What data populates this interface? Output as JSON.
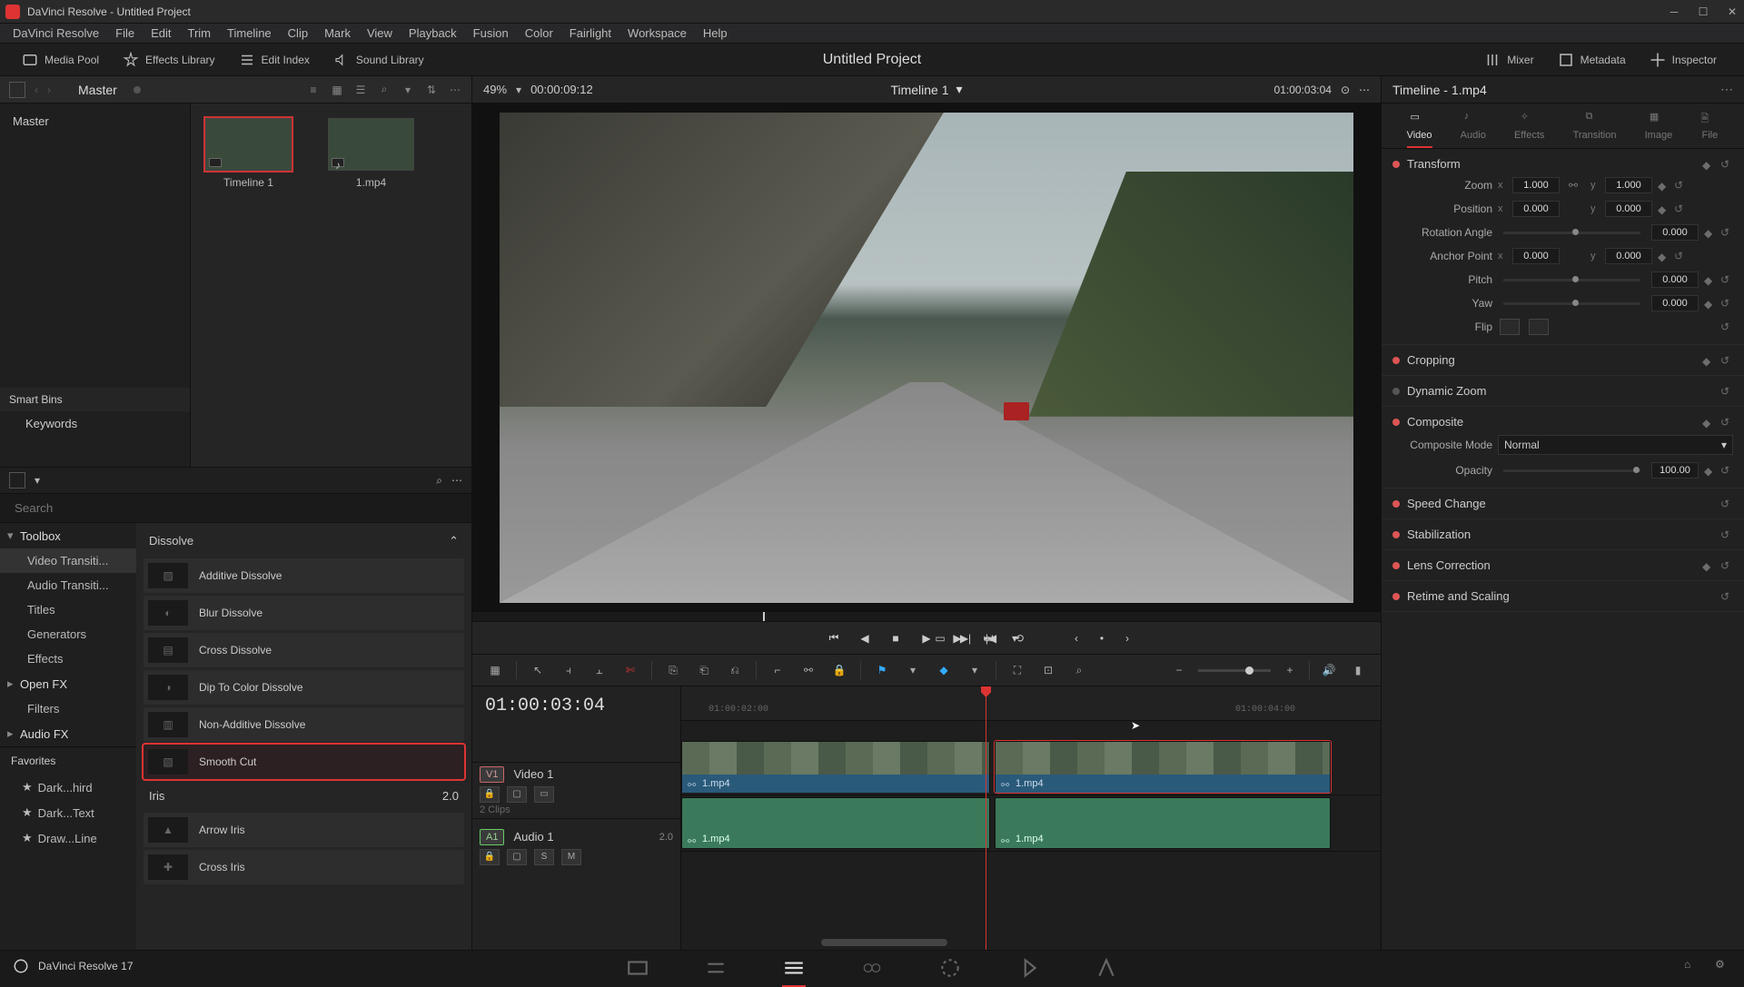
{
  "window": {
    "title": "DaVinci Resolve - Untitled Project"
  },
  "menu": [
    "DaVinci Resolve",
    "File",
    "Edit",
    "Trim",
    "Timeline",
    "Clip",
    "Mark",
    "View",
    "Playback",
    "Fusion",
    "Color",
    "Fairlight",
    "Workspace",
    "Help"
  ],
  "uibar": {
    "left": [
      {
        "label": "Media Pool"
      },
      {
        "label": "Effects Library"
      },
      {
        "label": "Edit Index"
      },
      {
        "label": "Sound Library"
      }
    ],
    "project": "Untitled Project",
    "right": [
      {
        "label": "Mixer"
      },
      {
        "label": "Metadata"
      },
      {
        "label": "Inspector"
      }
    ]
  },
  "mediapool": {
    "breadcrumb": "Master",
    "bin": "Master",
    "smart_header": "Smart Bins",
    "smart_items": [
      "Keywords"
    ],
    "thumbs": [
      {
        "label": "Timeline 1"
      },
      {
        "label": "1.mp4"
      }
    ]
  },
  "viewer": {
    "zoom": "49%",
    "source_tc": "00:00:09:12",
    "timeline_name": "Timeline 1",
    "record_tc": "01:00:03:04"
  },
  "fx": {
    "search_placeholder": "Search",
    "tree": [
      {
        "label": "Toolbox",
        "head": true
      },
      {
        "label": "Video Transiti...",
        "active": true
      },
      {
        "label": "Audio Transiti..."
      },
      {
        "label": "Titles"
      },
      {
        "label": "Generators"
      },
      {
        "label": "Effects"
      },
      {
        "label": "Open FX",
        "head": true
      },
      {
        "label": "Filters"
      },
      {
        "label": "Audio FX",
        "head": true
      }
    ],
    "cat1": "Dissolve",
    "items1": [
      "Additive Dissolve",
      "Blur Dissolve",
      "Cross Dissolve",
      "Dip To Color Dissolve",
      "Non-Additive Dissolve",
      "Smooth Cut"
    ],
    "selected": "Smooth Cut",
    "cat2": "Iris",
    "cat2_right": "2.0",
    "items2": [
      "Arrow Iris",
      "Cross Iris"
    ],
    "favorites_header": "Favorites",
    "favorites": [
      "Dark...hird",
      "Dark...Text",
      "Draw...Line"
    ]
  },
  "timeline": {
    "big_tc": "01:00:03:04",
    "ruler": [
      "01:00:02:00",
      "01:00:04:00"
    ],
    "tracks": {
      "video": {
        "badge": "V1",
        "name": "Video 1",
        "sub": "2 Clips"
      },
      "audio": {
        "badge": "A1",
        "name": "Audio 1",
        "right": "2.0"
      }
    },
    "clips": [
      {
        "name": "1.mp4"
      },
      {
        "name": "1.mp4"
      }
    ]
  },
  "inspector": {
    "title": "Timeline - 1.mp4",
    "tabs": [
      "Video",
      "Audio",
      "Effects",
      "Transition",
      "Image",
      "File"
    ],
    "transform": {
      "header": "Transform",
      "zoom_label": "Zoom",
      "zoom_x": "1.000",
      "zoom_y": "1.000",
      "pos_label": "Position",
      "pos_x": "0.000",
      "pos_y": "0.000",
      "rot_label": "Rotation Angle",
      "rot": "0.000",
      "anchor_label": "Anchor Point",
      "anchor_x": "0.000",
      "anchor_y": "0.000",
      "pitch_label": "Pitch",
      "pitch": "0.000",
      "yaw_label": "Yaw",
      "yaw": "0.000",
      "flip_label": "Flip"
    },
    "sections": [
      "Cropping",
      "Dynamic Zoom",
      "Composite",
      "Speed Change",
      "Stabilization",
      "Lens Correction",
      "Retime and Scaling"
    ],
    "composite": {
      "mode_label": "Composite Mode",
      "mode": "Normal",
      "opacity_label": "Opacity",
      "opacity": "100.00"
    }
  },
  "footer": {
    "version": "DaVinci Resolve 17"
  }
}
